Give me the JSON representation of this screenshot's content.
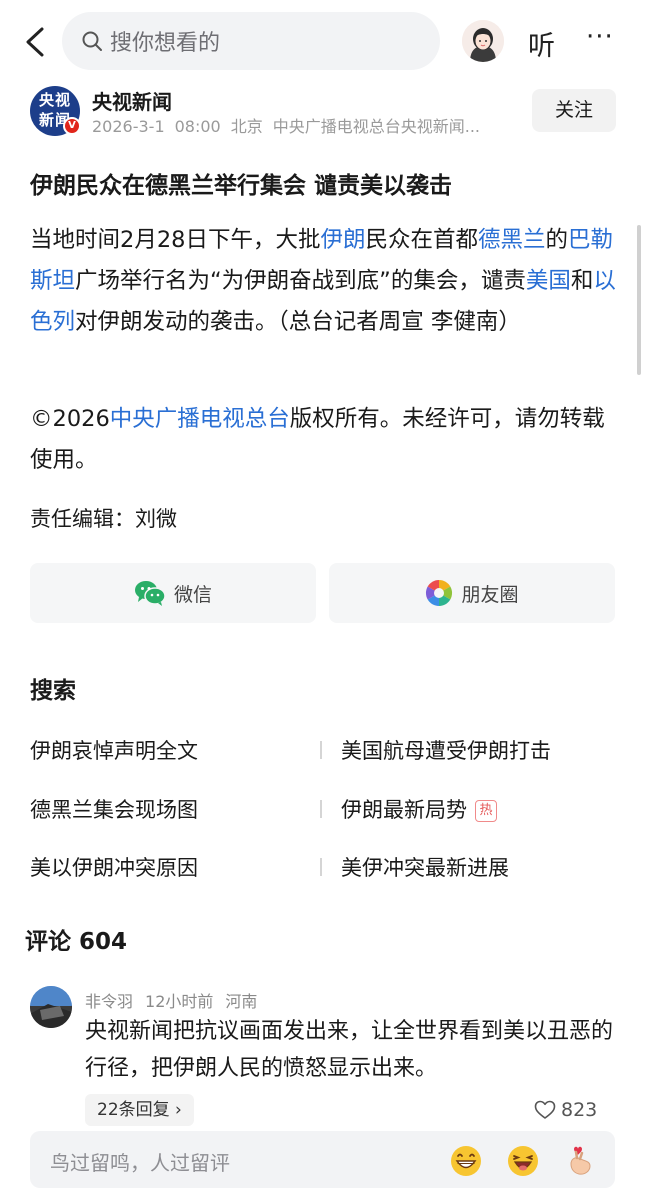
{
  "header": {
    "search_placeholder": "搜你想看的",
    "listen_label": "听",
    "more_label": "···"
  },
  "source": {
    "logo_text_line1": "央视",
    "logo_text_line2": "新闻",
    "verified_mark": "V",
    "name": "央视新闻",
    "date": "2026-3-1",
    "time": "08:00",
    "location": "北京",
    "publisher": "中央广播电视总台央视新闻...",
    "follow_label": "关注"
  },
  "article": {
    "title": "伊朗民众在德黑兰举行集会 谴责美以袭击",
    "p1": [
      {
        "t": "当地时间2月28日下午，大批",
        "link": false
      },
      {
        "t": "伊朗",
        "link": true
      },
      {
        "t": "民众在首都",
        "link": false
      },
      {
        "t": "德黑兰",
        "link": true
      },
      {
        "t": "的",
        "link": false
      },
      {
        "t": "巴勒斯坦",
        "link": true
      },
      {
        "t": "广场举行名为“为伊朗奋战到底”的集会，谴责",
        "link": false
      },
      {
        "t": "美国",
        "link": true
      },
      {
        "t": "和",
        "link": false
      },
      {
        "t": "以色列",
        "link": true
      },
      {
        "t": "对伊朗发动的袭击。（总台记者周宣 李健南）",
        "link": false
      }
    ],
    "p2": [
      {
        "t": "©2026",
        "link": false
      },
      {
        "t": "中央广播电视总台",
        "link": true
      },
      {
        "t": "版权所有。未经许可，请勿转载使用。",
        "link": false
      }
    ],
    "editor": "责任编辑：刘微"
  },
  "share": {
    "wechat_label": "微信",
    "moments_label": "朋友圈"
  },
  "search_section": {
    "title": "搜索",
    "suggestions": [
      {
        "text": "伊朗哀悼声明全文",
        "hot": false
      },
      {
        "text": "美国航母遭受伊朗打击",
        "hot": false
      },
      {
        "text": "德黑兰集会现场图",
        "hot": false
      },
      {
        "text": "伊朗最新局势",
        "hot": true
      },
      {
        "text": "美以伊朗冲突原因",
        "hot": false
      },
      {
        "text": "美伊冲突最新进展",
        "hot": false
      }
    ],
    "hot_badge": "热"
  },
  "comments": {
    "title": "评论 604",
    "items": [
      {
        "user": "非令羽",
        "time": "12小时前",
        "location": "河南",
        "text": "央视新闻把抗议画面发出来，让全世界看到美以丑恶的行径，把伊朗人民的愤怒显示出来。",
        "replies_label": "22条回复 ›",
        "likes": "823"
      }
    ]
  },
  "bottom_bar": {
    "placeholder": "鸟过留鸣，人过留评"
  },
  "colors": {
    "link": "#2a6fd4",
    "hot": "#e55b5b",
    "logo_bg": "#1d3e8a"
  }
}
